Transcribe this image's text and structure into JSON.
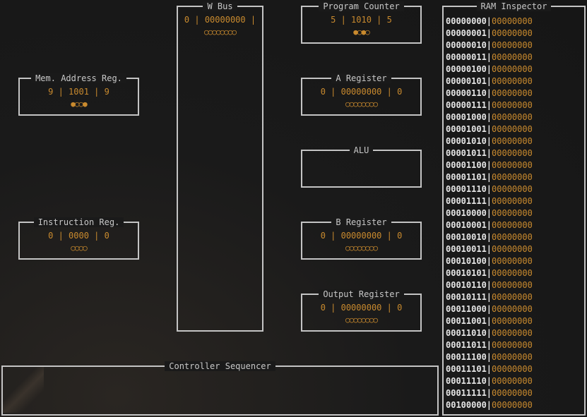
{
  "panels": {
    "w_bus": {
      "title": "W Bus",
      "value": "0 | 00000000 |",
      "leds": "○○○○○○○○"
    },
    "program_counter": {
      "title": "Program Counter",
      "value": "5 | 1010 | 5",
      "leds": "●○●○"
    },
    "mar": {
      "title": "Mem. Address Reg.",
      "value": "9 | 1001 | 9",
      "leds": "●○○●"
    },
    "a_register": {
      "title": "A Register",
      "value": "0 | 00000000 | 0",
      "leds": "○○○○○○○○"
    },
    "alu": {
      "title": "ALU"
    },
    "instruction_reg": {
      "title": "Instruction Reg.",
      "value": "0 | 0000 | 0",
      "leds": "○○○○"
    },
    "b_register": {
      "title": "B Register",
      "value": "0 | 00000000 | 0",
      "leds": "○○○○○○○○"
    },
    "output_register": {
      "title": "Output Register",
      "value": "0 | 00000000 | 0",
      "leds": "○○○○○○○○"
    },
    "controller": {
      "title": "Controller Sequencer"
    }
  },
  "ram": {
    "title": "RAM Inspector",
    "rows": [
      {
        "addr": "00000000",
        "data": "00000000"
      },
      {
        "addr": "00000001",
        "data": "00000000"
      },
      {
        "addr": "00000010",
        "data": "00000000"
      },
      {
        "addr": "00000011",
        "data": "00000000"
      },
      {
        "addr": "00000100",
        "data": "00000000"
      },
      {
        "addr": "00000101",
        "data": "00000000"
      },
      {
        "addr": "00000110",
        "data": "00000000"
      },
      {
        "addr": "00000111",
        "data": "00000000"
      },
      {
        "addr": "00001000",
        "data": "00000000"
      },
      {
        "addr": "00001001",
        "data": "00000000"
      },
      {
        "addr": "00001010",
        "data": "00000000"
      },
      {
        "addr": "00001011",
        "data": "00000000"
      },
      {
        "addr": "00001100",
        "data": "00000000"
      },
      {
        "addr": "00001101",
        "data": "00000000"
      },
      {
        "addr": "00001110",
        "data": "00000000"
      },
      {
        "addr": "00001111",
        "data": "00000000"
      },
      {
        "addr": "00010000",
        "data": "00000000"
      },
      {
        "addr": "00010001",
        "data": "00000000"
      },
      {
        "addr": "00010010",
        "data": "00000000"
      },
      {
        "addr": "00010011",
        "data": "00000000"
      },
      {
        "addr": "00010100",
        "data": "00000000"
      },
      {
        "addr": "00010101",
        "data": "00000000"
      },
      {
        "addr": "00010110",
        "data": "00000000"
      },
      {
        "addr": "00010111",
        "data": "00000000"
      },
      {
        "addr": "00011000",
        "data": "00000000"
      },
      {
        "addr": "00011001",
        "data": "00000000"
      },
      {
        "addr": "00011010",
        "data": "00000000"
      },
      {
        "addr": "00011011",
        "data": "00000000"
      },
      {
        "addr": "00011100",
        "data": "00000000"
      },
      {
        "addr": "00011101",
        "data": "00000000"
      },
      {
        "addr": "00011110",
        "data": "00000000"
      },
      {
        "addr": "00011111",
        "data": "00000000"
      },
      {
        "addr": "00100000",
        "data": "00000000"
      }
    ]
  },
  "colors": {
    "accent": "#c98a2e",
    "border": "#c4c4c4",
    "background": "#1a1a1a"
  }
}
